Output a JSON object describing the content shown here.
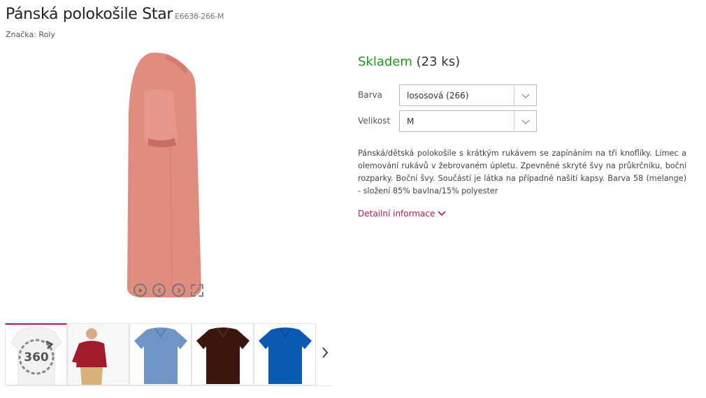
{
  "product": {
    "title": "Pánská polokošile Star",
    "code": "E6638-266-M",
    "brand": "Značka: Roly"
  },
  "gallery": {
    "controls": [
      "play-icon",
      "prev-icon",
      "next-icon",
      "fullscreen-icon"
    ],
    "thumbnails": [
      {
        "name": "360 view",
        "label": "360",
        "color": "#f2f2f2"
      },
      {
        "name": "model-red",
        "color": "#a11d2e"
      },
      {
        "name": "polo-blue",
        "color": "#6f95c7"
      },
      {
        "name": "polo-brown",
        "color": "#3a160e"
      },
      {
        "name": "polo-royal",
        "color": "#0b5bb5"
      }
    ],
    "main_color": "#e08c7e"
  },
  "stock": {
    "status": "Skladem",
    "count": "(23 ks)",
    "status_color": "#1e9a1e"
  },
  "options": {
    "color_label": "Barva",
    "color_value": "lososová (266)",
    "size_label": "Velikost",
    "size_value": "M"
  },
  "description": "Pánská/dětská polokošile s krátkým rukávem se zapínáním na tři knoflíky. Límec a olemování rukávů v žebrovaném úpletu. Zpevněné skryté švy na průkrčníku, boční rozparky. Boční švy. Součástí je látka na případné našití kapsy. Barva 58 (melange) - složení 85% bavlna/15% polyester",
  "detail_link": "Detailní informace",
  "accent_color": "#b0175e"
}
